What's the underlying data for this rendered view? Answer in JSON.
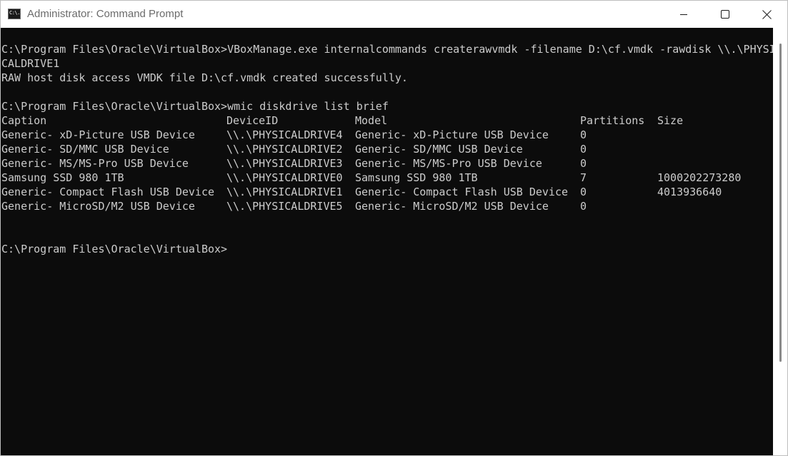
{
  "window": {
    "title": "Administrator: Command Prompt",
    "app_icon": "command-prompt-icon",
    "app_icon_glyph": "C:\\."
  },
  "controls": {
    "minimize_icon": "minimize-icon",
    "maximize_icon": "maximize-icon",
    "close_icon": "close-icon"
  },
  "console": {
    "colors": {
      "background": "#0c0c0c",
      "text": "#cccccc"
    },
    "cmd1": "C:\\Program Files\\Oracle\\VirtualBox>VBoxManage.exe internalcommands createrawvmdk -filename D:\\cf.vmdk -rawdisk \\\\.\\PHYSI",
    "cmd1_wrap": "CALDRIVE1",
    "cmd1_output": "RAW host disk access VMDK file D:\\cf.vmdk created successfully.",
    "cmd2": "C:\\Program Files\\Oracle\\VirtualBox>wmic diskdrive list brief",
    "table": {
      "headers": [
        "Caption",
        "DeviceID",
        "Model",
        "Partitions",
        "Size"
      ],
      "rows": [
        [
          "Generic- xD-Picture USB Device",
          "\\\\.\\PHYSICALDRIVE4",
          "Generic- xD-Picture USB Device",
          "0",
          ""
        ],
        [
          "Generic- SD/MMC USB Device",
          "\\\\.\\PHYSICALDRIVE2",
          "Generic- SD/MMC USB Device",
          "0",
          ""
        ],
        [
          "Generic- MS/MS-Pro USB Device",
          "\\\\.\\PHYSICALDRIVE3",
          "Generic- MS/MS-Pro USB Device",
          "0",
          ""
        ],
        [
          "Samsung SSD 980 1TB",
          "\\\\.\\PHYSICALDRIVE0",
          "Samsung SSD 980 1TB",
          "7",
          "1000202273280"
        ],
        [
          "Generic- Compact Flash USB Device",
          "\\\\.\\PHYSICALDRIVE1",
          "Generic- Compact Flash USB Device",
          "0",
          "4013936640"
        ],
        [
          "Generic- MicroSD/M2 USB Device",
          "\\\\.\\PHYSICALDRIVE5",
          "Generic- MicroSD/M2 USB Device",
          "0",
          ""
        ]
      ]
    },
    "prompt": "C:\\Program Files\\Oracle\\VirtualBox>"
  }
}
